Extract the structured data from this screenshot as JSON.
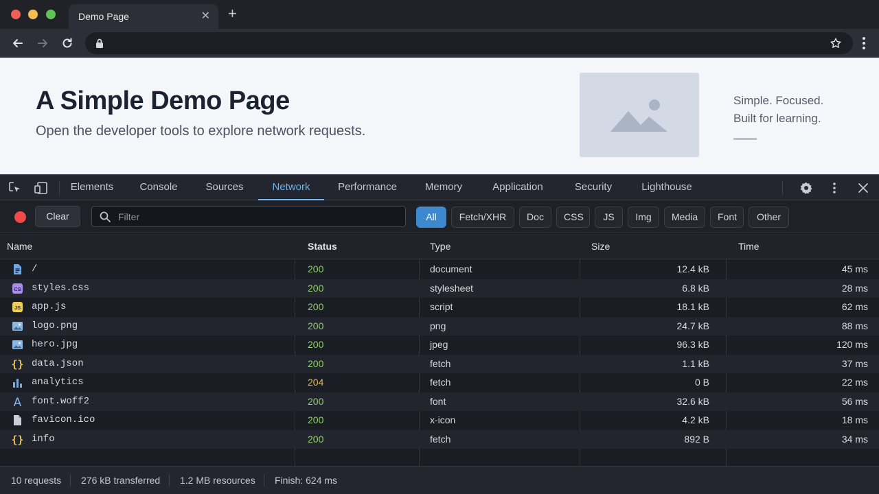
{
  "browser": {
    "tab_title": "Demo Page",
    "tab_close": "✕",
    "new_tab": "+"
  },
  "page": {
    "title": "A Simple Demo Page",
    "subtitle": "Open the developer tools to explore network requests.",
    "tagline_line1": "Simple. Focused.",
    "tagline_line2": "Built for learning."
  },
  "devtools": {
    "tabs": [
      "Elements",
      "Console",
      "Sources",
      "Network",
      "Performance",
      "Memory",
      "Application",
      "Security",
      "Lighthouse"
    ],
    "active_tab": "Network",
    "clear_label": "Clear",
    "filter_placeholder": "Filter",
    "type_filters": [
      "All",
      "Fetch/XHR",
      "Doc",
      "CSS",
      "JS",
      "Img",
      "Media",
      "Font",
      "Other"
    ],
    "active_filter": "All",
    "columns": {
      "name": "Name",
      "status": "Status",
      "type": "Type",
      "size": "Size",
      "time": "Time"
    },
    "requests": [
      {
        "icon": "document-icon",
        "name": "/",
        "status": "200",
        "type": "document",
        "size": "12.4 kB",
        "time": "45 ms"
      },
      {
        "icon": "css-file-icon",
        "name": "styles.css",
        "status": "200",
        "type": "stylesheet",
        "size": "6.8 kB",
        "time": "28 ms"
      },
      {
        "icon": "js-file-icon",
        "name": "app.js",
        "status": "200",
        "type": "script",
        "size": "18.1 kB",
        "time": "62 ms"
      },
      {
        "icon": "image-file-icon",
        "name": "logo.png",
        "status": "200",
        "type": "png",
        "size": "24.7 kB",
        "time": "88 ms"
      },
      {
        "icon": "image-file-icon",
        "name": "hero.jpg",
        "status": "200",
        "type": "jpeg",
        "size": "96.3 kB",
        "time": "120 ms"
      },
      {
        "icon": "json-braces-icon",
        "name": "data.json",
        "status": "200",
        "type": "fetch",
        "size": "1.1 kB",
        "time": "37 ms"
      },
      {
        "icon": "bar-chart-icon",
        "name": "analytics",
        "status": "204",
        "type": "fetch",
        "size": "0 B",
        "time": "22 ms"
      },
      {
        "icon": "font-icon",
        "name": "font.woff2",
        "status": "200",
        "type": "font",
        "size": "32.6 kB",
        "time": "56 ms"
      },
      {
        "icon": "blank-file-icon",
        "name": "favicon.ico",
        "status": "200",
        "type": "x-icon",
        "size": "4.2 kB",
        "time": "18 ms"
      },
      {
        "icon": "json-braces-icon",
        "name": "info",
        "status": "200",
        "type": "fetch",
        "size": "892 B",
        "time": "34 ms"
      }
    ],
    "summary": {
      "requests": "10 requests",
      "transferred": "276 kB transferred",
      "resources": "1.2 MB resources",
      "finish": "Finish: 624 ms"
    }
  },
  "colors": {
    "accent": "#6cb6f3",
    "status_ok": "#8fd06b",
    "status_no_content": "#e5b945",
    "record": "#ef4a4a"
  }
}
